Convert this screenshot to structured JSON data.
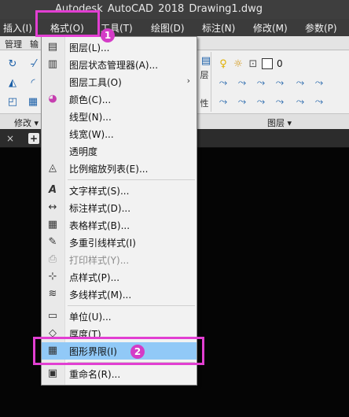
{
  "window": {
    "title": "Autodesk AutoCAD 2018     Drawing1.dwg"
  },
  "menubar": {
    "items": [
      {
        "label": "插入(I)",
        "name": "menu-insert"
      },
      {
        "label": "格式(O)",
        "name": "menu-format"
      },
      {
        "label": "工具(T)",
        "name": "menu-tools"
      },
      {
        "label": "绘图(D)",
        "name": "menu-draw"
      },
      {
        "label": "标注(N)",
        "name": "menu-dimension"
      },
      {
        "label": "修改(M)",
        "name": "menu-modify"
      },
      {
        "label": "参数(P)",
        "name": "menu-parametric"
      }
    ]
  },
  "ribbon": {
    "tabs": [
      {
        "label": "管理"
      },
      {
        "label": "输"
      }
    ],
    "layer_value": "0",
    "panel_labels": {
      "modify": "修改 ▾",
      "layers": "图层 ▾",
      "partial_1": "层",
      "partial_2": "性"
    }
  },
  "file_tabs": {
    "close": "×",
    "new_tab": "+"
  },
  "format_menu": {
    "items": [
      {
        "label": "图层(L)...",
        "icon": "layer-icon",
        "glyph": "▤",
        "disabled": false
      },
      {
        "label": "图层状态管理器(A)...",
        "icon": "layer-state-icon",
        "glyph": "▥",
        "disabled": false
      },
      {
        "label": "图层工具(O)",
        "icon": "",
        "glyph": "",
        "disabled": false,
        "submenu": "›"
      },
      {
        "label": "颜色(C)...",
        "icon": "color-wheel-icon",
        "glyph": "◕",
        "disabled": false
      },
      {
        "label": "线型(N)...",
        "icon": "",
        "glyph": "",
        "disabled": false
      },
      {
        "label": "线宽(W)...",
        "icon": "",
        "glyph": "",
        "disabled": false
      },
      {
        "label": "透明度",
        "icon": "",
        "glyph": "",
        "disabled": false
      },
      {
        "label": "比例缩放列表(E)...",
        "icon": "scale-list-icon",
        "glyph": "◬",
        "disabled": false
      },
      {
        "label": "文字样式(S)...",
        "icon": "text-style-icon",
        "glyph": "A",
        "disabled": false
      },
      {
        "label": "标注样式(D)...",
        "icon": "dimension-style-icon",
        "glyph": "↔",
        "disabled": false
      },
      {
        "label": "表格样式(B)...",
        "icon": "table-style-icon",
        "glyph": "▦",
        "disabled": false
      },
      {
        "label": "多重引线样式(I)",
        "icon": "multileader-style-icon",
        "glyph": "✎",
        "disabled": false
      },
      {
        "label": "打印样式(Y)...",
        "icon": "plot-style-icon",
        "glyph": "⎙",
        "disabled": true
      },
      {
        "label": "点样式(P)...",
        "icon": "point-style-icon",
        "glyph": "⊹",
        "disabled": false
      },
      {
        "label": "多线样式(M)...",
        "icon": "multiline-style-icon",
        "glyph": "≋",
        "disabled": false
      },
      {
        "label": "单位(U)...",
        "icon": "units-icon",
        "glyph": "▭",
        "disabled": false
      },
      {
        "label": "厚度(T)",
        "icon": "thickness-icon",
        "glyph": "◇",
        "disabled": false
      },
      {
        "label": "图形界限(I)",
        "icon": "drawing-limits-icon",
        "glyph": "▦",
        "disabled": false,
        "highlighted": true
      },
      {
        "label": "重命名(R)...",
        "icon": "rename-icon",
        "glyph": "▣",
        "disabled": false
      }
    ]
  },
  "annotations": {
    "badge_1": "1",
    "badge_2": "2"
  },
  "colors": {
    "highlight": "#91c9f7",
    "annotation": "#e23fd2",
    "menubar_bg": "#3b3b3b"
  }
}
